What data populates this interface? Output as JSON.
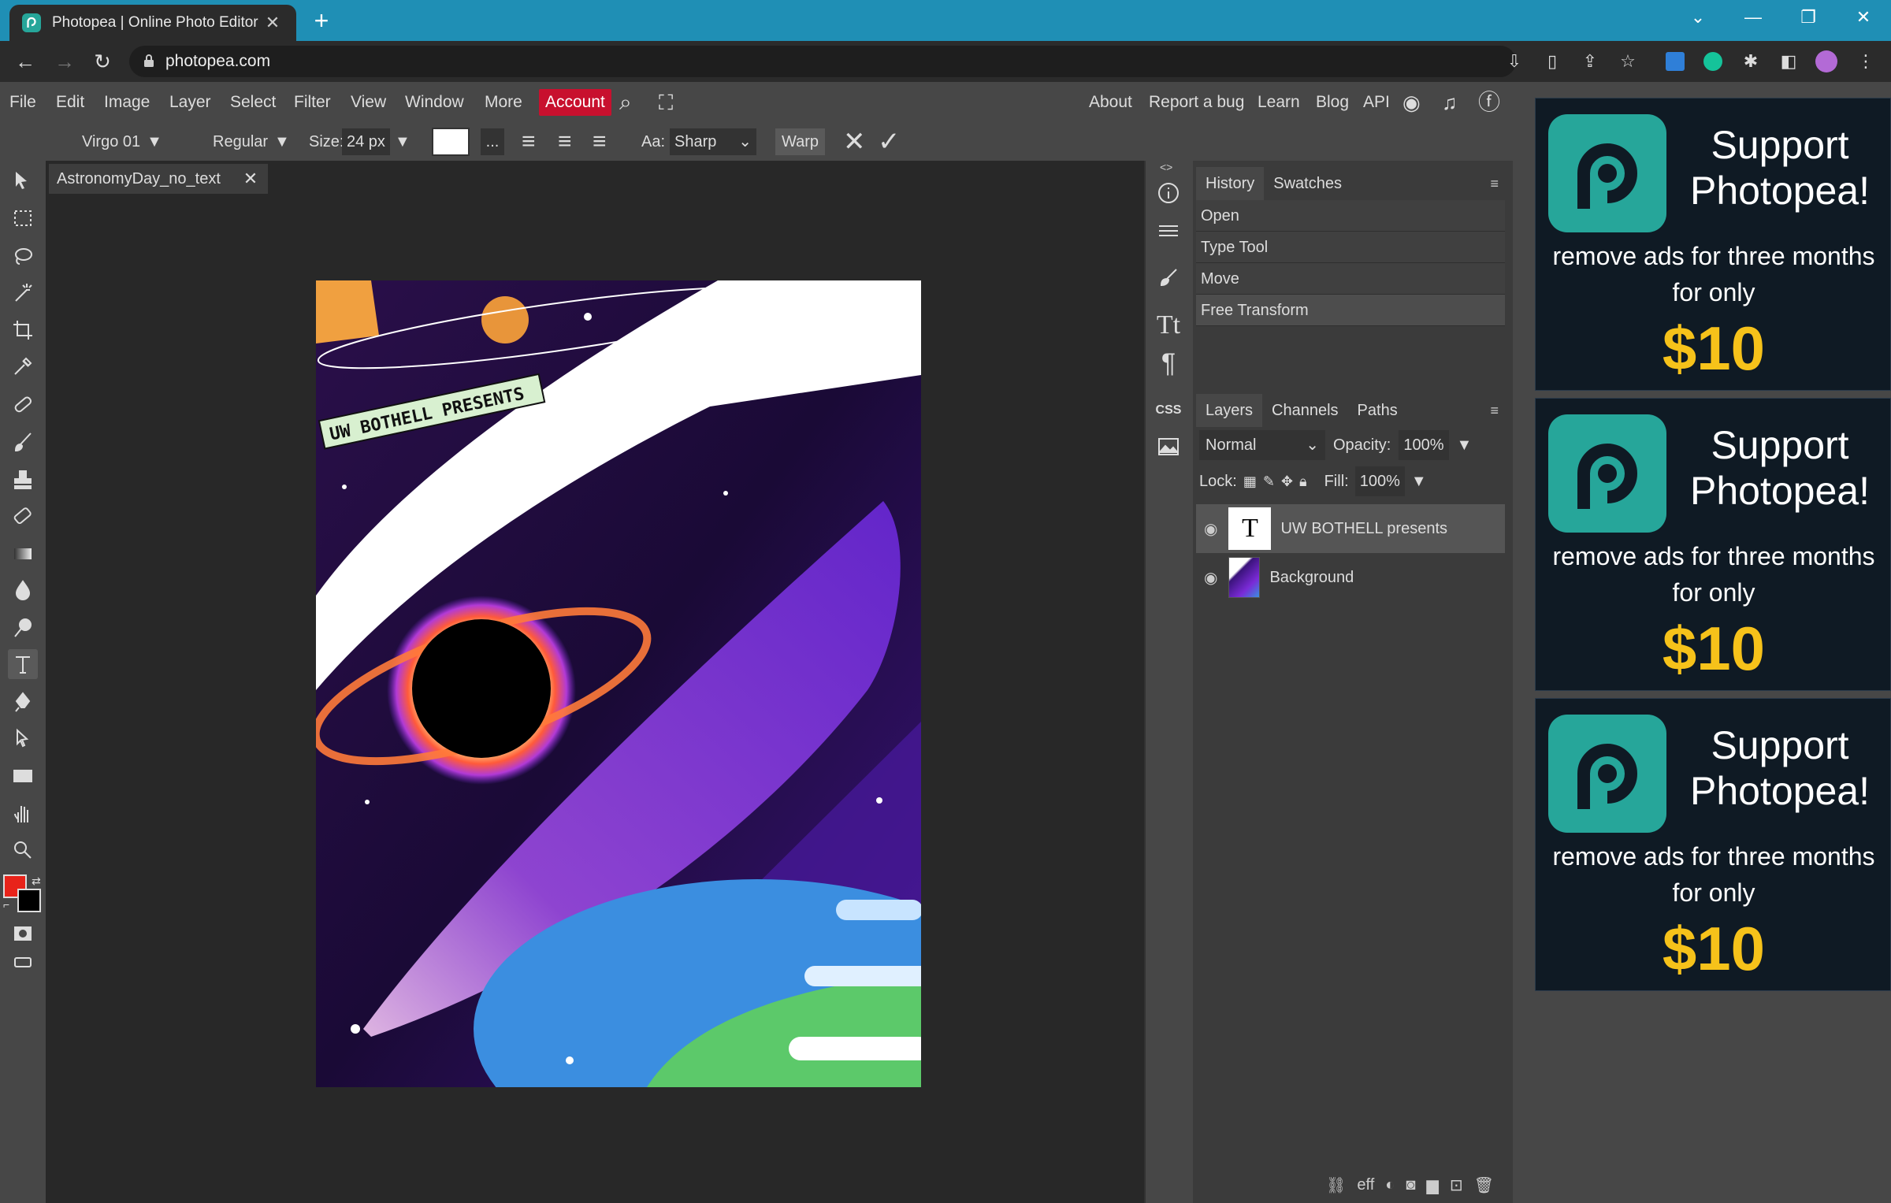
{
  "browser": {
    "tab_title": "Photopea | Online Photo Editor",
    "url": "photopea.com"
  },
  "menu": {
    "items": [
      "File",
      "Edit",
      "Image",
      "Layer",
      "Select",
      "Filter",
      "View",
      "Window",
      "More"
    ],
    "account": "Account",
    "right": [
      "About",
      "Report a bug",
      "Learn",
      "Blog",
      "API"
    ]
  },
  "options": {
    "font": "Virgo 01",
    "style": "Regular",
    "size_label": "Size:",
    "size": "24 px",
    "aa_label": "Aa:",
    "aa": "Sharp",
    "warp": "Warp",
    "more": "..."
  },
  "document": {
    "tab_name": "AstronomyDay_no_text",
    "banner_text": "UW BOTHELL PRESENTS"
  },
  "history": {
    "tabs": [
      "History",
      "Swatches"
    ],
    "items": [
      "Open",
      "Type Tool",
      "Move",
      "Free Transform"
    ]
  },
  "layers": {
    "tabs": [
      "Layers",
      "Channels",
      "Paths"
    ],
    "blend": "Normal",
    "opacity_label": "Opacity:",
    "opacity": "100%",
    "lock_label": "Lock:",
    "fill_label": "Fill:",
    "fill": "100%",
    "rows": [
      {
        "name": "UW BOTHELL presents",
        "thumb": "T"
      },
      {
        "name": "Background"
      }
    ],
    "footer": [
      "eff"
    ]
  },
  "ads": [
    {
      "line1": "Support",
      "line2": "Photopea!",
      "line3": "remove ads for three months",
      "line4": "for only",
      "price": "$10"
    },
    {
      "line1": "Support",
      "line2": "Photopea!",
      "line3": "remove ads for three months",
      "line4": "for only",
      "price": "$10"
    },
    {
      "line1": "Support",
      "line2": "Photopea!",
      "line3": "remove ads for three months",
      "line4": "for only",
      "price": "$10"
    }
  ],
  "colors": {
    "foreground": "#e8231a",
    "background": "#000000",
    "accent": "#c8102e",
    "brand": "#26a69a",
    "price": "#f6c21a"
  }
}
